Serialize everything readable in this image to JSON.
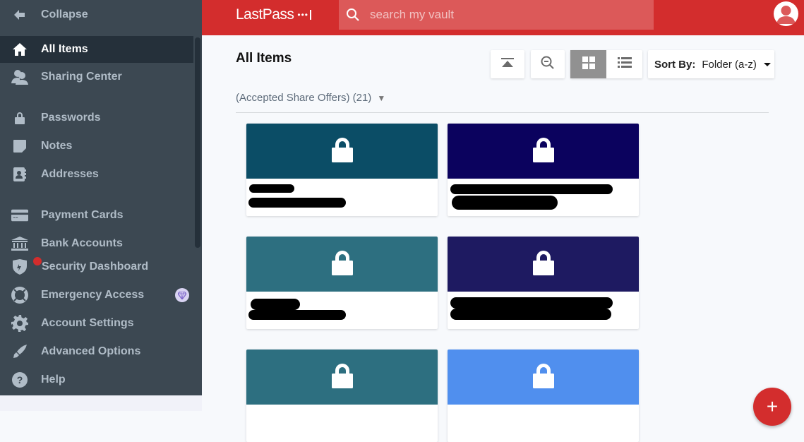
{
  "sidebar": {
    "items": [
      {
        "label": "Collapse",
        "icon": "arrow-left-icon"
      },
      {
        "label": "All Items",
        "icon": "home-icon",
        "active": true
      },
      {
        "label": "Sharing Center",
        "icon": "users-icon"
      },
      {
        "label": "Passwords",
        "icon": "lock-icon"
      },
      {
        "label": "Notes",
        "icon": "note-icon"
      },
      {
        "label": "Addresses",
        "icon": "address-book-icon"
      },
      {
        "label": "Payment Cards",
        "icon": "credit-card-icon"
      },
      {
        "label": "Bank Accounts",
        "icon": "bank-icon"
      },
      {
        "label": "Security Dashboard",
        "icon": "shield-icon"
      },
      {
        "label": "Emergency Access",
        "icon": "life-ring-icon"
      },
      {
        "label": "Account Settings",
        "icon": "gear-icon"
      },
      {
        "label": "Advanced Options",
        "icon": "rocket-icon"
      },
      {
        "label": "Help",
        "icon": "question-icon"
      }
    ]
  },
  "header": {
    "logo": "LastPass",
    "logo_dots": "•••",
    "search_placeholder": "search my vault"
  },
  "main": {
    "title": "All Items",
    "sort_label": "Sort By:",
    "sort_value": "Folder (a-z)",
    "folder_label": "(Accepted Share Offers) (21)",
    "folder_caret": "▼",
    "cards": [
      {
        "color": "#0b4d66"
      },
      {
        "color": "#0b025e"
      },
      {
        "color": "#2d6f80"
      },
      {
        "color": "#1e1a61"
      },
      {
        "color": "#2d6f80"
      },
      {
        "color": "#508fee"
      }
    ]
  },
  "fab_label": "+"
}
